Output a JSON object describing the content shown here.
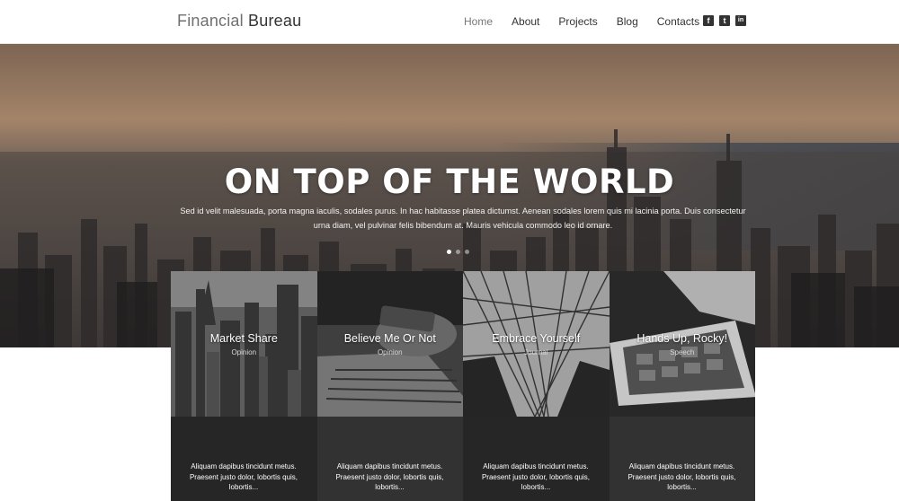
{
  "header": {
    "logo_part1": "Financial",
    "logo_part2": "Bureau",
    "nav": [
      "Home",
      "About",
      "Projects",
      "Blog",
      "Contacts"
    ],
    "socials": [
      {
        "icon": "facebook-icon",
        "glyph": "f"
      },
      {
        "icon": "twitter-icon",
        "glyph": "t"
      },
      {
        "icon": "linkedin-icon",
        "glyph": "in"
      }
    ]
  },
  "hero": {
    "title": "ON TOP OF THE WORLD",
    "text_line1": "Sed id velit malesuada, porta magna iaculis, sodales purus. In hac habitasse platea dictumst. Aenean sodales lorem quis mi lacinia porta. Duis consectetur",
    "text_line2": "urna diam, vel pulvinar felis bibendum at. Mauris vehicula commodo leo id ornare.",
    "slides_total": 3,
    "slide_active": 1
  },
  "cards": [
    {
      "title": "Market Share",
      "category": "Opinion",
      "text_line1": "Aliquam dapibus tincidunt metus.",
      "text_line2": "Praesent justo dolor, lobortis quis,",
      "text_line3": "lobortis..."
    },
    {
      "title": "Believe Me Or Not",
      "category": "Opinion",
      "text_line1": "Aliquam dapibus tincidunt metus.",
      "text_line2": "Praesent justo dolor, lobortis quis,",
      "text_line3": "lobortis..."
    },
    {
      "title": "Embrace Yourself",
      "category": "Journal",
      "text_line1": "Aliquam dapibus tincidunt metus.",
      "text_line2": "Praesent justo dolor, lobortis quis,",
      "text_line3": "lobortis..."
    },
    {
      "title": "Hands Up, Rocky!",
      "category": "Speech",
      "text_line1": "Aliquam dapibus tincidunt metus.",
      "text_line2": "Praesent justo dolor, lobortis quis,",
      "text_line3": "lobortis..."
    }
  ],
  "colors": {
    "accent_dark": "#262626",
    "accent_mid": "#323232",
    "nav_active": "#777777"
  }
}
